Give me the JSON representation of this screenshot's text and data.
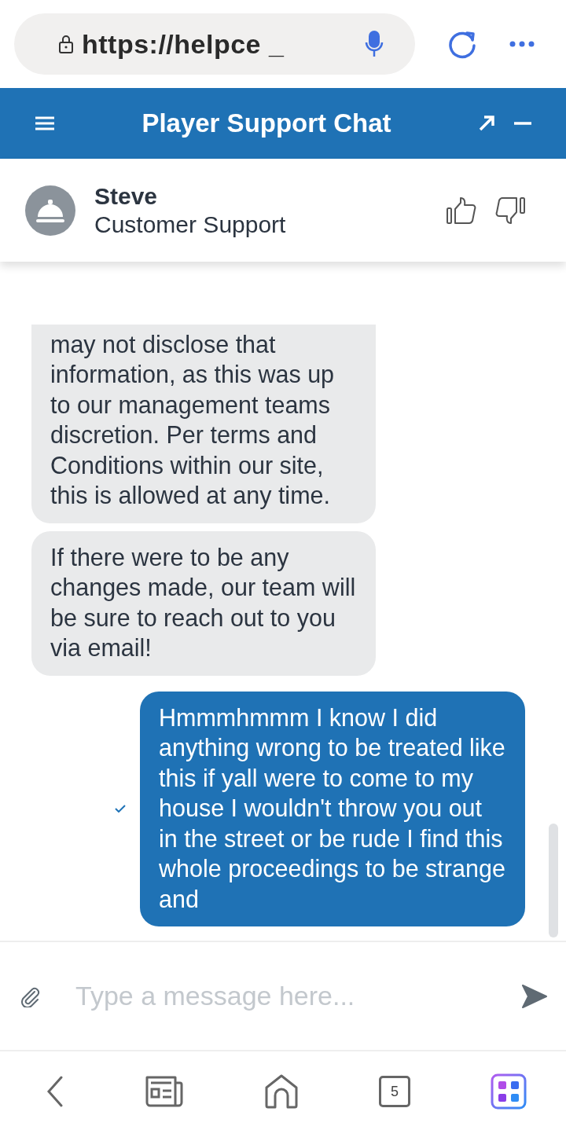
{
  "browser": {
    "url": "https://helpce _",
    "tab_count": "5"
  },
  "header": {
    "title": "Player Support Chat"
  },
  "agent": {
    "name": "Steve",
    "role": "Customer Support"
  },
  "messages": [
    {
      "kind": "agent",
      "text": "may not disclose that information, as this was up to our management teams discretion. Per terms and Conditions within our site, this is allowed at any time."
    },
    {
      "kind": "agent",
      "text": "If there were to be any changes made, our team will be sure to reach out to you via email!"
    },
    {
      "kind": "user",
      "text": "Hmmmhmmm I know I did anything wrong to be treated like this if yall were to come to my house I wouldn't throw you out in the street or be rude I find this whole proceedings to be strange and"
    }
  ],
  "composer": {
    "placeholder": "Type a message here..."
  }
}
